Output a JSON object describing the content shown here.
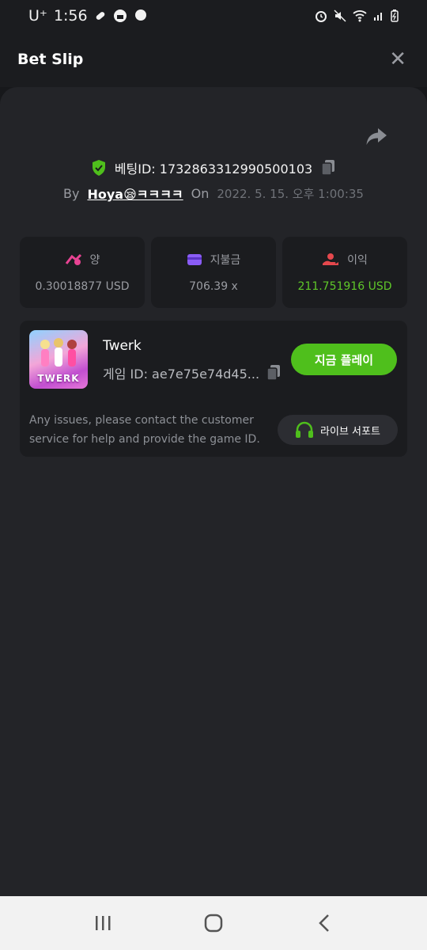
{
  "status": {
    "carrier": "U⁺",
    "time": "1:56",
    "left_icons": [
      "pill-icon",
      "lock-badge-icon",
      "chat-bubble-icon"
    ],
    "right_icons": [
      "alarm-icon",
      "mute-icon",
      "wifi-icon",
      "signal-icon",
      "battery-icon"
    ]
  },
  "header": {
    "title": "Bet Slip",
    "close_label": "✕"
  },
  "bet": {
    "id_label": "베팅ID: 1732863312990500103",
    "by_label": "By",
    "username": "Hoya😪ㅋㅋㅋㅋ",
    "on_label": "On",
    "date": "2022. 5. 15. 오후 1:00:35"
  },
  "stats": [
    {
      "label": "양",
      "value": "0.30018877 USD",
      "icon": "amount-icon",
      "color": "#e84393"
    },
    {
      "label": "지불금",
      "value": "706.39 x",
      "icon": "wallet-icon",
      "color": "#8a5cf6"
    },
    {
      "label": "이익",
      "value": "211.751916 USD",
      "icon": "profit-hand-icon",
      "color": "#e5484d"
    }
  ],
  "game": {
    "name": "Twerk",
    "thumb_text": "TWERK",
    "id_label": "게임 ID: ae7e75e74d45...",
    "play_label": "지금 플레이",
    "help_text": "Any issues, please contact the customer service for help and provide the game ID.",
    "support_label": "라이브 서포트"
  },
  "colors": {
    "accent_green": "#4fbf1c",
    "profit_green": "#5fc829",
    "background": "#17181b",
    "panel": "#232428"
  }
}
